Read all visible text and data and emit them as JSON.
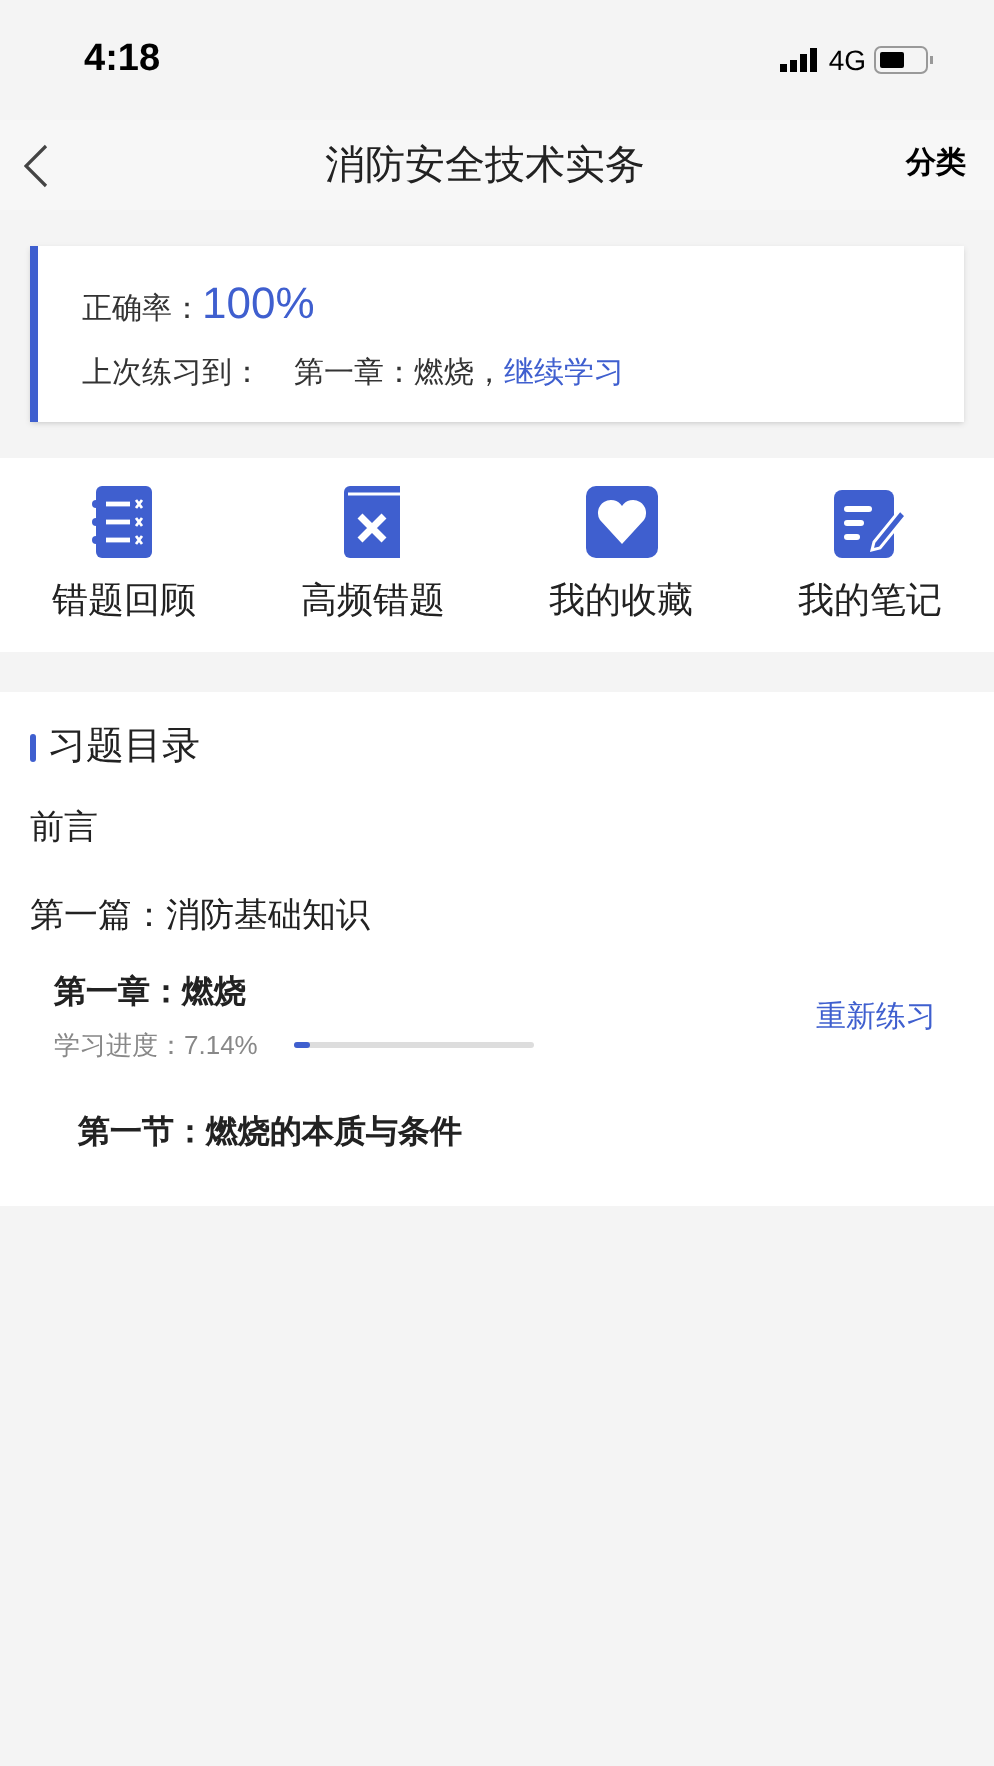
{
  "status_bar": {
    "time": "4:18",
    "network": "4G"
  },
  "nav": {
    "title": "消防安全技术实务",
    "action": "分类"
  },
  "summary": {
    "accuracy_label": "正确率：",
    "accuracy_value": "100%",
    "last_label": "上次练习到：",
    "last_chapter": "第一章：燃烧，",
    "continue_link": "继续学习"
  },
  "shortcuts": [
    {
      "kind": "list",
      "label": "错题回顾"
    },
    {
      "kind": "book",
      "label": "高频错题"
    },
    {
      "kind": "heart",
      "label": "我的收藏"
    },
    {
      "kind": "note",
      "label": "我的笔记"
    }
  ],
  "catalog": {
    "title": "习题目录",
    "items": [
      {
        "kind": "part",
        "label": "前言"
      },
      {
        "kind": "part",
        "label": "第一篇：消防基础知识",
        "children": [
          {
            "kind": "chapter",
            "label": "第一章：燃烧",
            "progress_label": "学习进度：7.14%",
            "level": 0.0714,
            "action": "重新练习",
            "children": [
              {
                "kind": "section",
                "label": "第一节：燃烧的本质与条件"
              }
            ]
          }
        ]
      }
    ]
  }
}
